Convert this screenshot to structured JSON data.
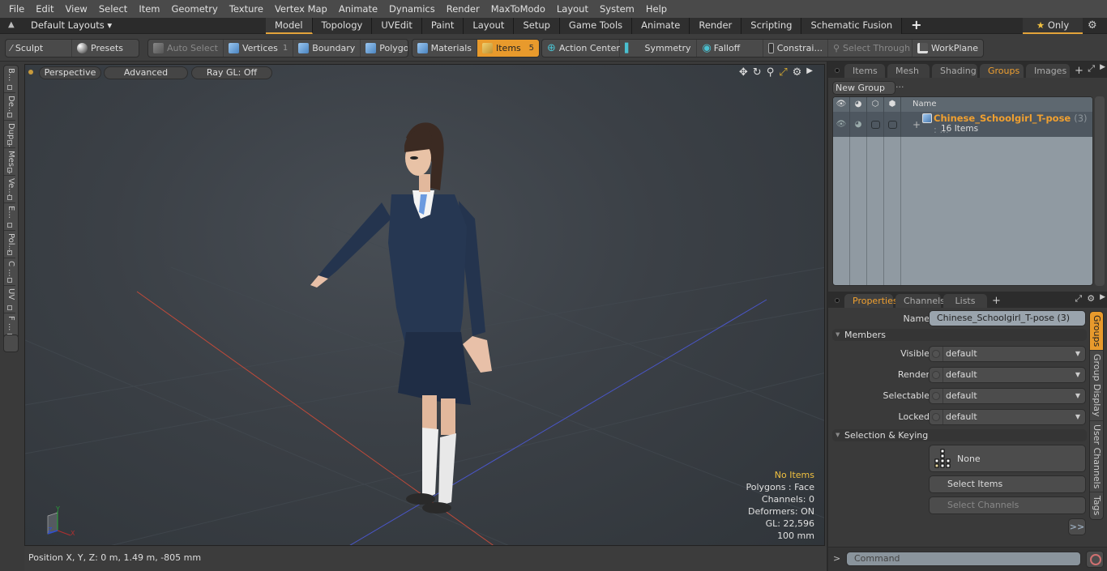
{
  "menubar": {
    "items": [
      "File",
      "Edit",
      "View",
      "Select",
      "Item",
      "Geometry",
      "Texture",
      "Vertex Map",
      "Animate",
      "Dynamics",
      "Render",
      "MaxToModo",
      "Layout",
      "System",
      "Help"
    ]
  },
  "layoutbar": {
    "layouts_label": "Default Layouts ▾",
    "tabs": [
      "Model",
      "Topology",
      "UVEdit",
      "Paint",
      "Layout",
      "Setup",
      "Game Tools",
      "Animate",
      "Render",
      "Scripting",
      "Schematic Fusion"
    ],
    "active_tab": "Model",
    "only_label": "Only"
  },
  "toolbar": {
    "sculpt": "Sculpt",
    "presets": "Presets",
    "auto_select": "Auto Select",
    "vertices": "Vertices",
    "vertices_count": "1",
    "boundary": "Boundary",
    "polygons": "Polygons",
    "materials": "Materials",
    "items": "Items",
    "items_count": "5",
    "action_center": "Action Center",
    "symmetry": "Symmetry",
    "falloff": "Falloff",
    "constraints": "Constrai...",
    "select_through": "Select Through",
    "workplane": "WorkPlane"
  },
  "left_tabs": [
    "B...",
    "De...",
    "Dup...",
    "Mes...",
    "Ve...",
    "E...",
    "Pol...",
    "C ...",
    "UV",
    "F ..."
  ],
  "viewport": {
    "view_mode": "Perspective",
    "shading": "Advanced",
    "raygl": "Ray GL: Off",
    "stats": {
      "selection": "No Items",
      "polygons": "Polygons : Face",
      "channels": "Channels: 0",
      "deformers": "Deformers: ON",
      "gl": "GL: 22,596",
      "grid": "100 mm"
    },
    "axis_labels": {
      "x": "X",
      "y": "Y",
      "z": "Z"
    }
  },
  "statusbar": {
    "position": "Position X, Y, Z:   0 m, 1.49 m, -805 mm"
  },
  "groups_panel": {
    "tabs": [
      "Items",
      "Mesh ...",
      "Shading",
      "Groups",
      "Images"
    ],
    "active_tab": "Groups",
    "new_group": "New Group",
    "column_name": "Name",
    "group": {
      "name": "Chinese_Schoolgirl_T-pose",
      "count": "(3) : ...",
      "sub": "16 Items"
    }
  },
  "properties_panel": {
    "tabs": [
      "Properties",
      "Channels",
      "Lists"
    ],
    "active_tab": "Properties",
    "name_label": "Name",
    "name_value": "Chinese_Schoolgirl_T-pose (3)",
    "members_section": "Members",
    "fields": [
      {
        "label": "Visible",
        "value": "default"
      },
      {
        "label": "Render",
        "value": "default"
      },
      {
        "label": "Selectable",
        "value": "default"
      },
      {
        "label": "Locked",
        "value": "default"
      }
    ],
    "selection_section": "Selection & Keying",
    "none_label": "None",
    "select_items": "Select Items",
    "select_channels": "Select Channels",
    "more": ">>",
    "side_tabs": [
      "Groups",
      "Group Display",
      "User Channels",
      "Tags"
    ]
  },
  "command": {
    "prompt": ">",
    "placeholder": "Command"
  }
}
